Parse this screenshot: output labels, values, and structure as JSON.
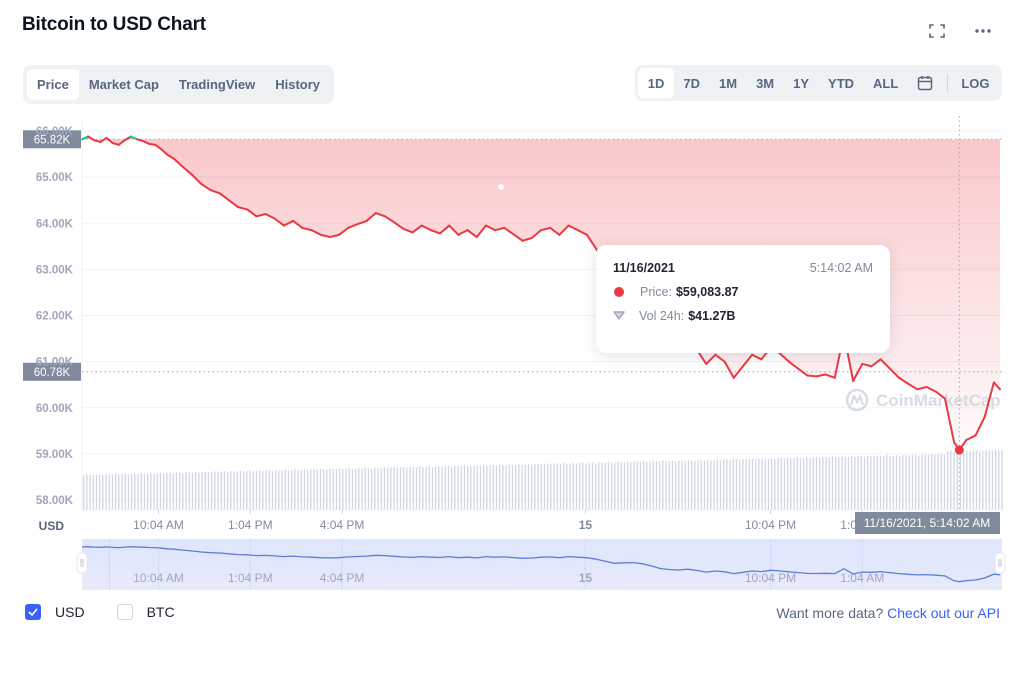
{
  "header": {
    "title": "Bitcoin to USD Chart",
    "fullscreen_icon": "fullscreen-icon",
    "more_icon": "more-horizontal-icon"
  },
  "tabs": [
    {
      "label": "Price",
      "active": true
    },
    {
      "label": "Market Cap",
      "active": false
    },
    {
      "label": "TradingView",
      "active": false
    },
    {
      "label": "History",
      "active": false
    }
  ],
  "ranges": [
    {
      "label": "1D",
      "active": true
    },
    {
      "label": "7D",
      "active": false
    },
    {
      "label": "1M",
      "active": false
    },
    {
      "label": "3M",
      "active": false
    },
    {
      "label": "1Y",
      "active": false
    },
    {
      "label": "YTD",
      "active": false
    },
    {
      "label": "ALL",
      "active": false
    }
  ],
  "calendar_icon": "calendar-icon",
  "log_label": "LOG",
  "tooltip": {
    "date": "11/16/2021",
    "time": "5:14:02 AM",
    "price_label": "Price:",
    "price_value": "$59,083.87",
    "vol_label": "Vol 24h:",
    "vol_value": "$41.27B"
  },
  "crosshair": {
    "time_label": "11/16/2021, 5:14:02 AM",
    "open_price_label": "65.82K",
    "current_price_label": "60.78K"
  },
  "legend": [
    {
      "label": "USD",
      "checked": true
    },
    {
      "label": "BTC",
      "checked": false
    }
  ],
  "api_prompt": "Want more data?",
  "api_link": "Check out our API",
  "watermark": "CoinMarketCap",
  "colors": {
    "down": "#ea3943",
    "up": "#16c784",
    "accent": "#3861fb",
    "volume": "#cfd6e4",
    "navigator_fill": "#e3e8fb",
    "navigator_line": "#5b7fd6"
  },
  "chart_data": {
    "type": "line",
    "title": "Bitcoin to USD Chart",
    "xlabel": "",
    "ylabel": "USD",
    "ylim": [
      58000,
      66000
    ],
    "yticks": [
      "58.00K",
      "59.00K",
      "60.00K",
      "61.00K",
      "62.00K",
      "63.00K",
      "64.00K",
      "65.00K",
      "66.00K"
    ],
    "ytick_values": [
      58000,
      59000,
      60000,
      61000,
      62000,
      63000,
      64000,
      65000,
      66000
    ],
    "xticks": [
      "10:04 AM",
      "1:04 PM",
      "4:04 PM",
      "15",
      "10:04 PM",
      "1:04 AM"
    ],
    "xtick_positions_hours": [
      2.5,
      5.5,
      8.5,
      16.45,
      22.5,
      25.5
    ],
    "x_range_hours": [
      0,
      30
    ],
    "grid": true,
    "reference_line_open": 65820,
    "reference_line_current": 60780,
    "highlight_point": {
      "hour": 28.67,
      "price": 59083.87
    },
    "series": [
      {
        "name": "Price (USD)",
        "x_hours": [
          0,
          0.2,
          0.4,
          0.6,
          0.8,
          1.0,
          1.2,
          1.4,
          1.6,
          1.8,
          2.0,
          2.2,
          2.4,
          2.6,
          2.8,
          3.0,
          3.3,
          3.6,
          3.9,
          4.2,
          4.5,
          4.8,
          5.1,
          5.4,
          5.7,
          6.0,
          6.3,
          6.6,
          6.9,
          7.2,
          7.5,
          7.8,
          8.1,
          8.4,
          8.7,
          9.0,
          9.3,
          9.6,
          9.9,
          10.2,
          10.5,
          10.8,
          11.1,
          11.4,
          11.7,
          12.0,
          12.3,
          12.6,
          12.9,
          13.2,
          13.5,
          13.8,
          14.1,
          14.4,
          14.7,
          15.0,
          15.3,
          15.6,
          15.9,
          16.2,
          16.5,
          16.8,
          17.1,
          17.4,
          17.7,
          18.0,
          18.3,
          18.6,
          18.9,
          19.2,
          19.5,
          19.8,
          20.1,
          20.4,
          20.7,
          21.0,
          21.3,
          21.6,
          21.9,
          22.2,
          22.5,
          22.8,
          23.1,
          23.4,
          23.7,
          24.0,
          24.3,
          24.6,
          24.9,
          25.2,
          25.5,
          25.8,
          26.1,
          26.4,
          26.7,
          27.0,
          27.3,
          27.6,
          27.9,
          28.2,
          28.5,
          28.67,
          28.9,
          29.2,
          29.5,
          29.8,
          30.0
        ],
        "values": [
          65820,
          65880,
          65800,
          65760,
          65850,
          65740,
          65700,
          65800,
          65880,
          65820,
          65780,
          65720,
          65700,
          65600,
          65480,
          65400,
          65220,
          65050,
          64850,
          64720,
          64650,
          64500,
          64350,
          64300,
          64150,
          64200,
          64100,
          63950,
          64050,
          63900,
          63850,
          63750,
          63700,
          63750,
          63900,
          63980,
          64050,
          64220,
          64150,
          64020,
          63880,
          63800,
          63950,
          63850,
          63780,
          63950,
          63750,
          63850,
          63700,
          63950,
          63850,
          63900,
          63760,
          63620,
          63680,
          63850,
          63900,
          63750,
          63950,
          63850,
          63750,
          63450,
          63050,
          62650,
          62750,
          62800,
          62580,
          62150,
          61650,
          61450,
          61350,
          61500,
          61250,
          60950,
          61150,
          61000,
          60650,
          60900,
          61150,
          61050,
          61300,
          61180,
          61000,
          60850,
          60700,
          60680,
          60720,
          60650,
          61600,
          60580,
          60950,
          60900,
          61050,
          60850,
          60650,
          60520,
          60400,
          60450,
          60350,
          60200,
          59250,
          59083.87,
          59300,
          59400,
          59800,
          60550,
          60400
        ]
      },
      {
        "name": "Volume 24h",
        "note": "volume bars gradually rising across the day; latest value $41.27B"
      }
    ]
  }
}
